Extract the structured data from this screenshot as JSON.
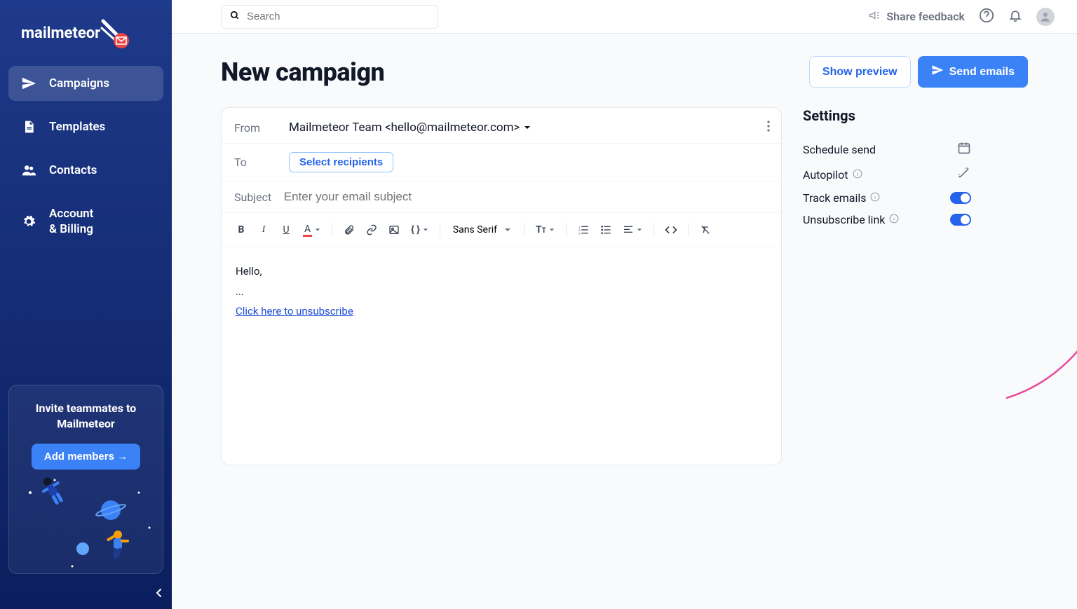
{
  "brand": "mailmeteor",
  "sidebar": {
    "items": [
      {
        "label": "Campaigns"
      },
      {
        "label": "Templates"
      },
      {
        "label": "Contacts"
      },
      {
        "label": "Account\n& Billing"
      }
    ],
    "invite": {
      "title": "Invite teammates to Mailmeteor",
      "button": "Add members →"
    }
  },
  "topbar": {
    "search_placeholder": "Search",
    "feedback": "Share feedback"
  },
  "page": {
    "title": "New campaign",
    "show_preview": "Show preview",
    "send_emails": "Send emails"
  },
  "editor": {
    "from_label": "From",
    "from_value": "Mailmeteor Team <hello@mailmeteor.com>",
    "to_label": "To",
    "select_recipients": "Select recipients",
    "subject_label": "Subject",
    "subject_placeholder": "Enter your email subject",
    "font": "Sans Serif",
    "body_line1": "Hello,",
    "body_line2": "...",
    "unsubscribe_link": "Click here to unsubscribe"
  },
  "settings": {
    "title": "Settings",
    "schedule": "Schedule send",
    "autopilot": "Autopilot",
    "track": "Track emails",
    "unsubscribe": "Unsubscribe link"
  }
}
